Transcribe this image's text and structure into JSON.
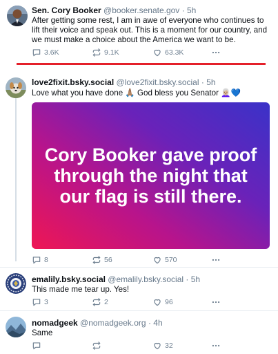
{
  "posts": [
    {
      "name": "Sen. Cory Booker",
      "handle": "@booker.senate.gov",
      "separator": "·",
      "time": "5h",
      "text": "After getting some rest, I am in awe of everyone who continues to lift their voice and speak out. This is a moment for our country, and we must make a choice about the America we want to be.",
      "replies": "3.6K",
      "reposts": "9.1K",
      "likes": "63.3K"
    },
    {
      "name": "love2fixit.bsky.social",
      "handle": "@love2fixit.bsky.social",
      "separator": "·",
      "time": "5h",
      "text": "Love what you have done 🙏🏽 God bless you Senator 👩🏼‍🦳💙",
      "media_text": "Cory Booker gave proof through the night that our flag is still there.",
      "replies": "8",
      "reposts": "56",
      "likes": "570"
    },
    {
      "name": "emalily.bsky.social",
      "handle": "@emalily.bsky.social",
      "separator": "·",
      "time": "5h",
      "text": "This made me tear up. Yes!",
      "replies": "3",
      "reposts": "2",
      "likes": "96"
    },
    {
      "name": "nomadgeek",
      "handle": "@nomadgeek.org",
      "separator": "·",
      "time": "4h",
      "text": "Same",
      "replies": "",
      "reposts": "",
      "likes": "32"
    }
  ],
  "colors": {
    "accent_red": "#e4202a",
    "like_blue": "#1d9bf0",
    "meta_gray": "#66788a",
    "gradient": [
      "#ee1654",
      "#b7148c",
      "#6a22b9",
      "#3a32c8"
    ]
  },
  "icons": [
    "reply-icon",
    "repost-icon",
    "like-icon",
    "more-icon"
  ]
}
